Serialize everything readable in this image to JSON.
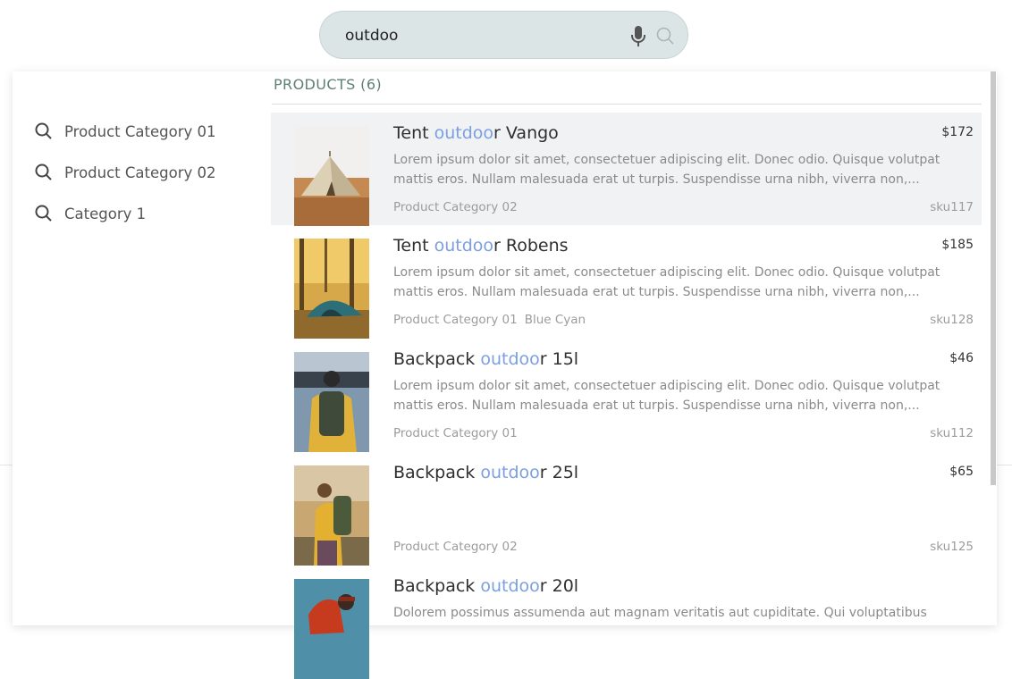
{
  "search": {
    "value": "outdoo",
    "mic_icon": "microphone-icon",
    "search_icon": "magnifier-icon"
  },
  "suggestions": [
    {
      "label": "Product Category 01",
      "icon": "search-icon"
    },
    {
      "label": "Product Category 02",
      "icon": "search-icon"
    },
    {
      "label": "Category 1",
      "icon": "search-icon"
    }
  ],
  "products_heading": "PRODUCTS (6)",
  "highlight_color": "#7b9fe0",
  "products": [
    {
      "title_pre": "Tent ",
      "title_hl": "outdoo",
      "title_post": "r Vango",
      "price": "$172",
      "desc1": "Lorem ipsum dolor sit amet, consectetuer adipiscing elit. Donec odio. Quisque volutpat",
      "desc2": "mattis eros. Nullam malesuada erat ut turpis. Suspendisse urna nibh, viverra non,...",
      "category": "Product Category 02",
      "tags": "",
      "sku": "sku117",
      "image": "bell-tent-photo"
    },
    {
      "title_pre": "Tent ",
      "title_hl": "outdoo",
      "title_post": "r Robens",
      "price": "$185",
      "desc1": "Lorem ipsum dolor sit amet, consectetuer adipiscing elit. Donec odio. Quisque volutpat",
      "desc2": "mattis eros. Nullam malesuada erat ut turpis. Suspendisse urna nibh, viverra non,...",
      "category": "Product Category 01",
      "tags": "Blue  Cyan",
      "sku": "sku128",
      "image": "dome-tent-photo"
    },
    {
      "title_pre": "Backpack ",
      "title_hl": "outdoo",
      "title_post": "r 15l",
      "price": "$46",
      "desc1": "Lorem ipsum dolor sit amet, consectetuer adipiscing elit. Donec odio. Quisque volutpat",
      "desc2": "mattis eros. Nullam malesuada erat ut turpis. Suspendisse urna nibh, viverra non,...",
      "category": "Product Category 01",
      "tags": "",
      "sku": "sku112",
      "image": "backpack-lake-photo"
    },
    {
      "title_pre": "Backpack ",
      "title_hl": "outdoo",
      "title_post": "r 25l",
      "price": "$65",
      "desc1": "",
      "desc2": "",
      "category": "Product Category 02",
      "tags": "",
      "sku": "sku125",
      "image": "hiker-backpack-photo"
    },
    {
      "title_pre": "Backpack ",
      "title_hl": "outdoo",
      "title_post": "r 20l",
      "price": "",
      "desc1": "Dolorem possimus assumenda aut magnam veritatis aut cupiditate. Qui voluptatibus",
      "desc2": "",
      "category": "",
      "tags": "",
      "sku": "",
      "image": "red-backpack-photo"
    }
  ]
}
